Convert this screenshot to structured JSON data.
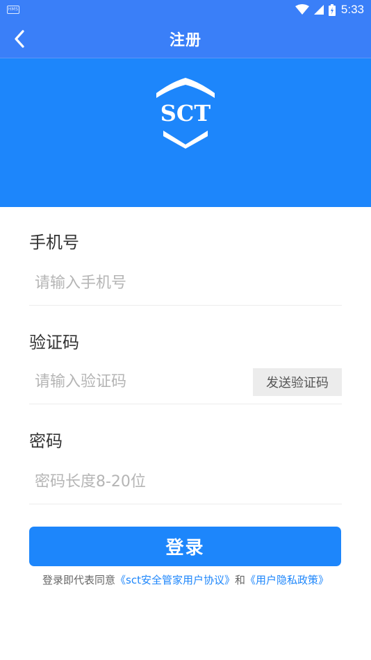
{
  "status_bar": {
    "app_icon_text": "HMS",
    "time": "5:33",
    "icons": [
      "wifi-icon",
      "cell-signal-icon",
      "battery-icon"
    ]
  },
  "nav": {
    "title": "注册",
    "back_icon": "chevron-left-icon"
  },
  "banner": {
    "logo_text": "SCT",
    "background": "#1d86fb"
  },
  "form": {
    "phone": {
      "label": "手机号",
      "placeholder": "请输入手机号",
      "value": ""
    },
    "code": {
      "label": "验证码",
      "placeholder": "请输入验证码",
      "value": "",
      "send_button": "发送验证码"
    },
    "password": {
      "label": "密码",
      "placeholder": "密码长度8-20位",
      "value": ""
    }
  },
  "submit_label": "登录",
  "agreement": {
    "prefix": "登录即代表同意",
    "terms_link": "《sct安全管家用户协议》",
    "joiner": "和",
    "privacy_link": "《用户隐私政策》"
  },
  "colors": {
    "header": "#3a7ff8",
    "accent": "#1d86fb",
    "placeholder": "#b5b5b5"
  }
}
